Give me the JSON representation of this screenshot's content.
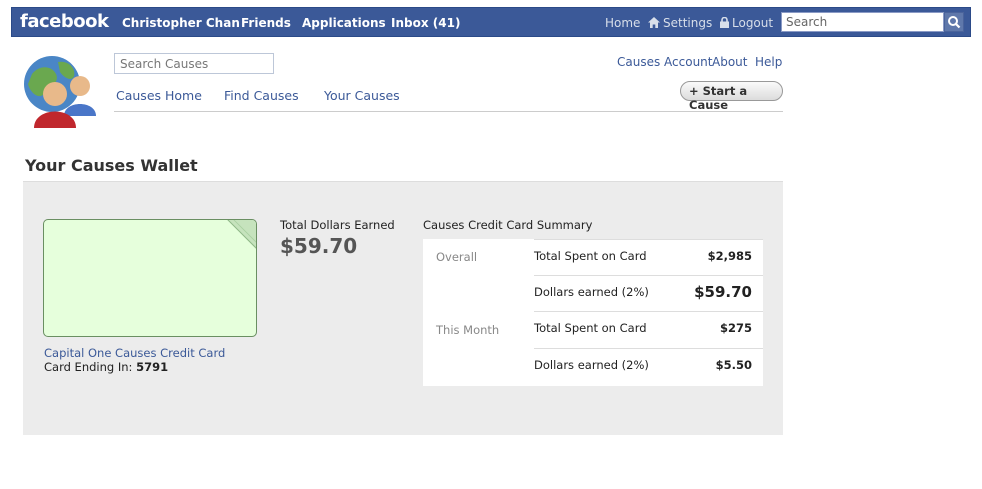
{
  "topbar": {
    "logo": "facebook",
    "nav": [
      "Christopher Chan",
      "Friends",
      "Applications",
      "Inbox (41)"
    ],
    "home": "Home",
    "settings": "Settings",
    "logout": "Logout",
    "search_placeholder": "Search"
  },
  "causes_header": {
    "search_placeholder": "Search Causes",
    "top_links": [
      "Causes Account",
      "About",
      "Help"
    ],
    "nav": [
      "Causes Home",
      "Find Causes",
      "Your Causes"
    ],
    "start_button": "+ Start a Cause"
  },
  "page_title": "Your Causes Wallet",
  "card": {
    "name": "Capital One Causes Credit Card",
    "ending_label": "Card Ending In:",
    "ending_digits": "5791",
    "color": "#e6ffdc"
  },
  "earned": {
    "label": "Total Dollars Earned",
    "value": "$59.70"
  },
  "summary": {
    "title": "Causes Credit Card Summary",
    "periods": [
      {
        "name": "Overall",
        "rows": [
          {
            "label": "Total Spent on Card",
            "value": "$2,985"
          },
          {
            "label": "Dollars earned (2%)",
            "value": "$59.70"
          }
        ]
      },
      {
        "name": "This Month",
        "rows": [
          {
            "label": "Total Spent on Card",
            "value": "$275"
          },
          {
            "label": "Dollars earned (2%)",
            "value": "$5.50"
          }
        ]
      }
    ]
  },
  "colors": {
    "facebook_blue": "#3b5998",
    "panel_gray": "#ececec"
  }
}
